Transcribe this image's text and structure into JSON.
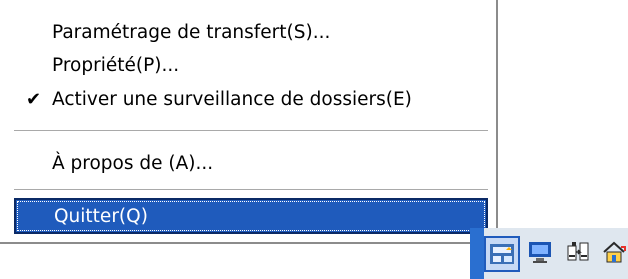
{
  "context_menu": {
    "items": [
      {
        "label": "Paramétrage de transfert(S)...",
        "checked": false
      },
      {
        "label": "Propriété(P)...",
        "checked": false
      },
      {
        "label": "Activer une surveillance de dossiers(E)",
        "checked": true,
        "check_glyph": "✔"
      }
    ],
    "about": {
      "label": "À propos de (A)..."
    },
    "quit": {
      "label": "Quitter(Q)",
      "selected": true
    }
  },
  "taskbar_tray": {
    "icons": [
      {
        "name": "scanner-transfer-icon"
      },
      {
        "name": "computer-monitor-icon"
      },
      {
        "name": "file-transfer-icon"
      },
      {
        "name": "home-network-icon"
      }
    ]
  },
  "colors": {
    "highlight_bg": "#1f5bbc",
    "highlight_text": "#ffffff",
    "menu_bg": "#ffffff",
    "separator": "#a9a9a9"
  }
}
